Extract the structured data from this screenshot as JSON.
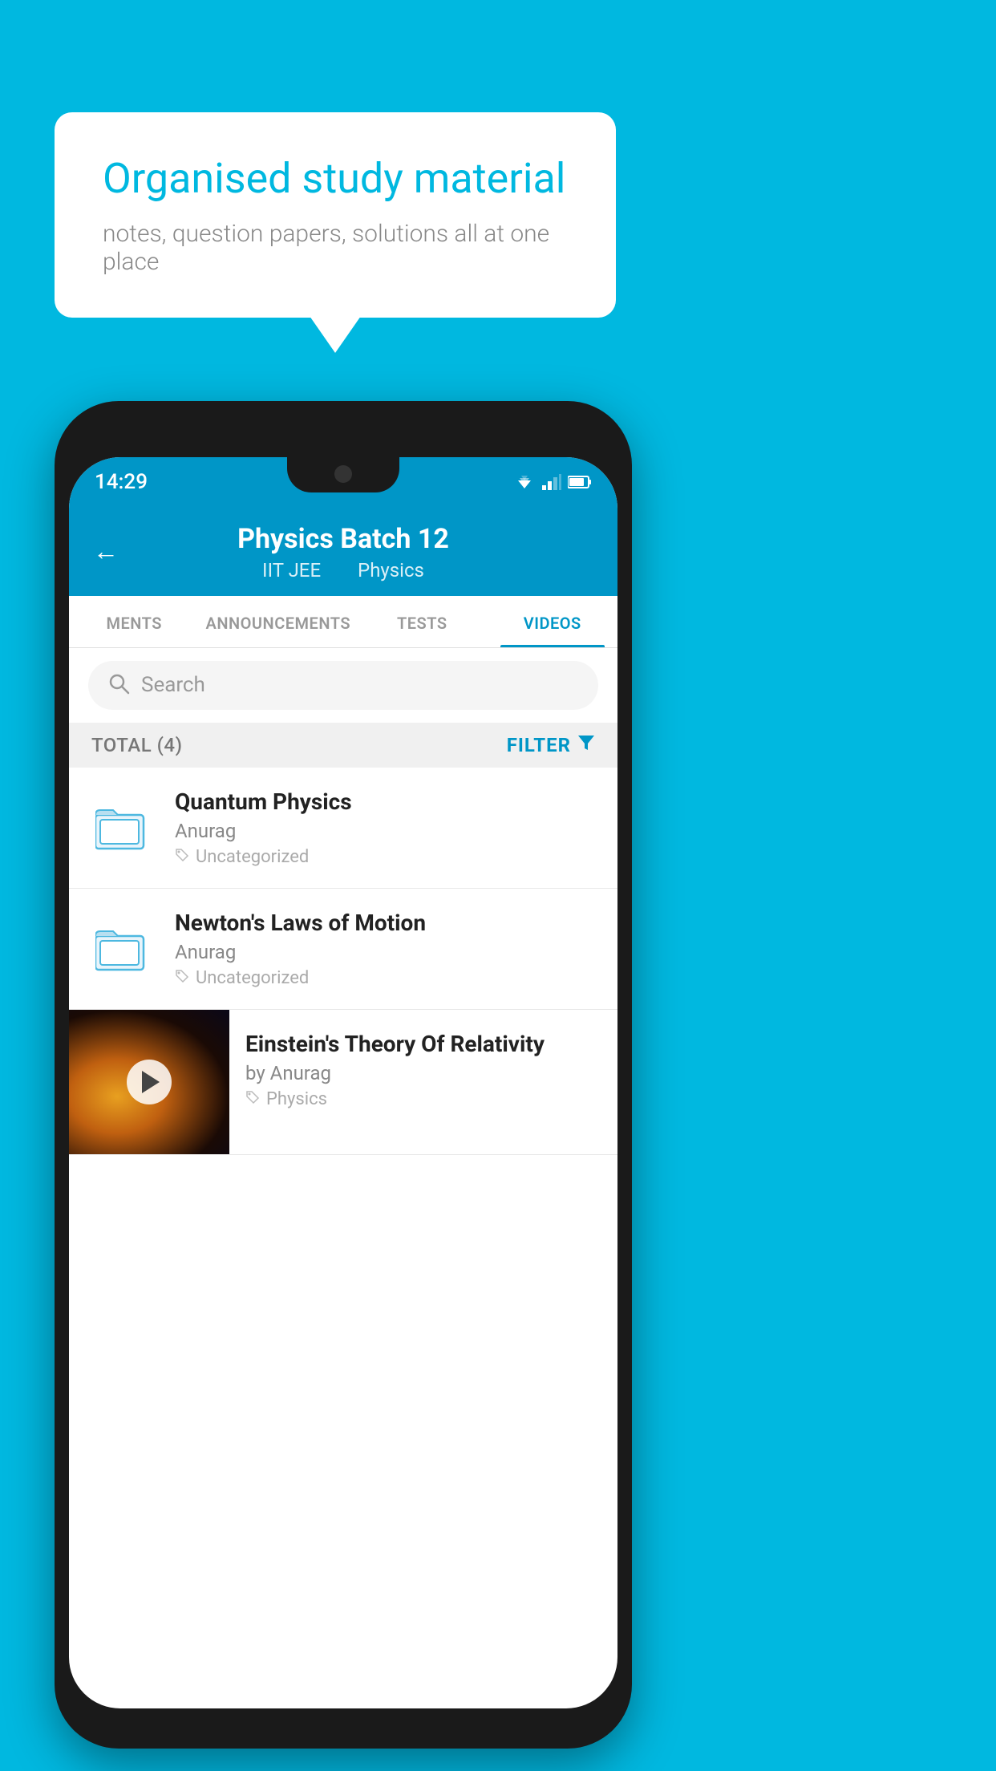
{
  "background_color": "#00b8e0",
  "speech_bubble": {
    "title": "Organised study material",
    "subtitle": "notes, question papers, solutions all at one place"
  },
  "status_bar": {
    "time": "14:29"
  },
  "app_header": {
    "back_label": "←",
    "title": "Physics Batch 12",
    "subtitle_part1": "IIT JEE",
    "subtitle_part2": "Physics"
  },
  "tabs": [
    {
      "label": "MENTS",
      "active": false
    },
    {
      "label": "ANNOUNCEMENTS",
      "active": false
    },
    {
      "label": "TESTS",
      "active": false
    },
    {
      "label": "VIDEOS",
      "active": true
    }
  ],
  "search": {
    "placeholder": "Search"
  },
  "filter_bar": {
    "total_label": "TOTAL (4)",
    "filter_label": "FILTER"
  },
  "video_items": [
    {
      "type": "folder",
      "title": "Quantum Physics",
      "author": "Anurag",
      "tag": "Uncategorized"
    },
    {
      "type": "folder",
      "title": "Newton's Laws of Motion",
      "author": "Anurag",
      "tag": "Uncategorized"
    },
    {
      "type": "thumbnail",
      "title": "Einstein's Theory Of Relativity",
      "author": "by Anurag",
      "tag": "Physics"
    }
  ]
}
